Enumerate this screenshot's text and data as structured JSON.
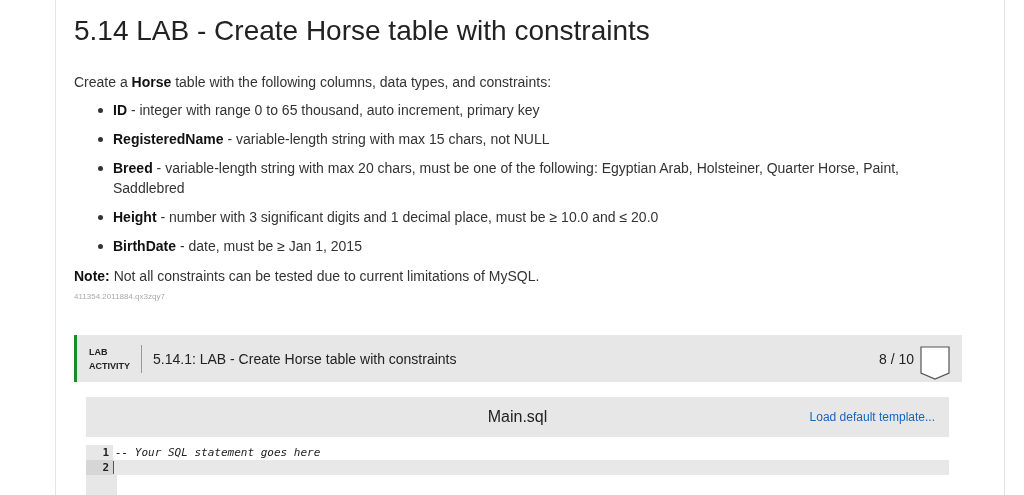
{
  "title": "5.14 LAB - Create Horse table with constraints",
  "intro": "Create a **Horse** table with the following columns, data types, and constraints:",
  "columns": [
    "**ID** - integer with range 0 to 65 thousand, auto increment, primary key",
    "**RegisteredName** - variable-length string with max 15 chars, not NULL",
    "**Breed** - variable-length string with max 20 chars, must be one of the following: Egyptian Arab, Holsteiner, Quarter Horse, Paint, Saddlebred",
    "**Height** - number with 3 significant digits and 1 decimal place, must be ≥ 10.0 and ≤ 20.0",
    "**BirthDate** - date, must be ≥ Jan 1, 2015"
  ],
  "note": "**Note:** Not all constraints can be tested due to current limitations of MySQL.",
  "code_id": "411354.2011884.qx3zqy7",
  "lab": {
    "label_line_1": "LAB",
    "label_line_2": "ACTIVITY",
    "title": "5.14.1: LAB - Create Horse table with constraints",
    "score": "8 / 10"
  },
  "editor": {
    "filename": "Main.sql",
    "template_link": "Load default template...",
    "lines": [
      {
        "number": "1",
        "text": "-- Your SQL statement goes here",
        "selected": false
      },
      {
        "number": "2",
        "selected": true
      }
    ]
  }
}
